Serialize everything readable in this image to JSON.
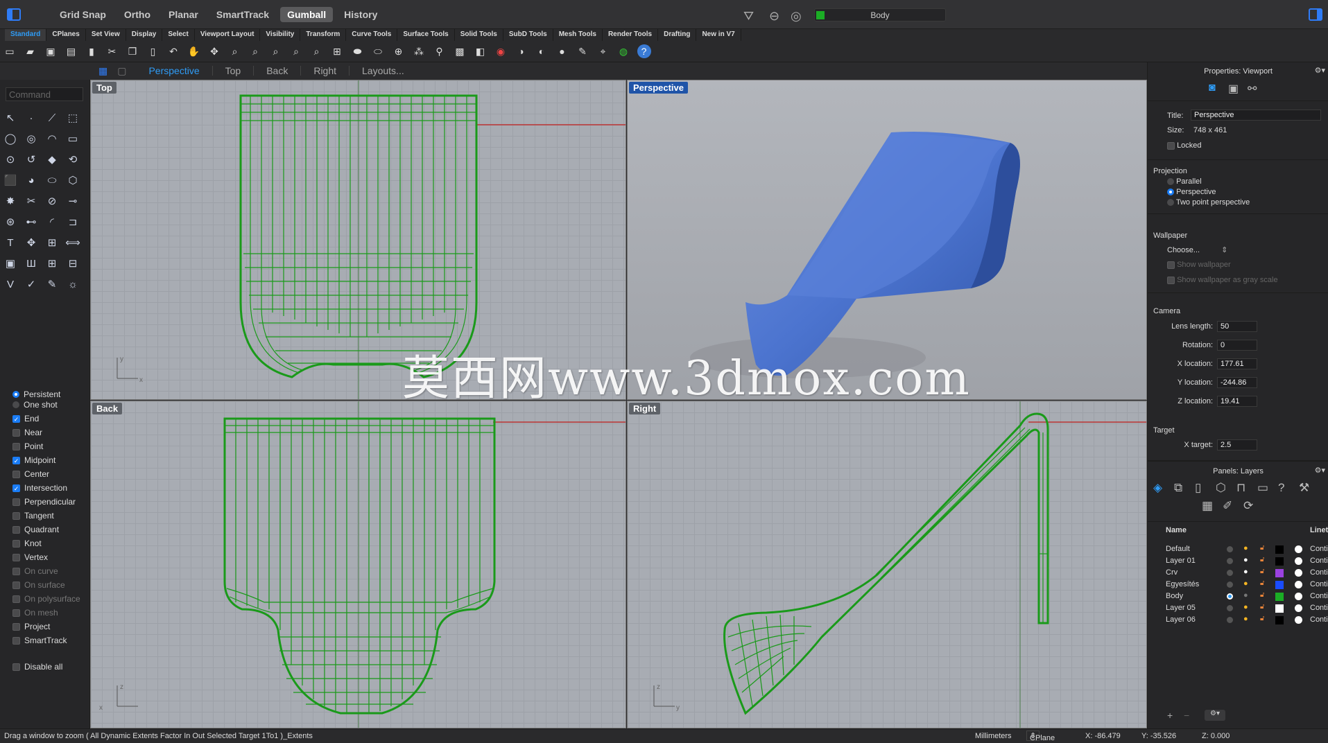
{
  "topbar": {
    "modes": [
      "Grid Snap",
      "Ortho",
      "Planar",
      "SmartTrack",
      "Gumball",
      "History"
    ],
    "active_mode": "Gumball",
    "layer": "Body",
    "layer_color": "#1bad25"
  },
  "tabs": [
    "Standard",
    "CPlanes",
    "Set View",
    "Display",
    "Select",
    "Viewport Layout",
    "Visibility",
    "Transform",
    "Curve Tools",
    "Surface Tools",
    "Solid Tools",
    "SubD Tools",
    "Mesh Tools",
    "Render Tools",
    "Drafting",
    "New in V7"
  ],
  "active_tab": "Standard",
  "viewport_tabs": [
    "Perspective",
    "Top",
    "Back",
    "Right",
    "Layouts..."
  ],
  "active_viewport_tab": "Perspective",
  "command_placeholder": "Command",
  "osnaps": [
    {
      "label": "Persistent",
      "type": "radio",
      "on": true
    },
    {
      "label": "One shot",
      "type": "radio",
      "on": false
    },
    {
      "label": "End",
      "type": "check",
      "on": true
    },
    {
      "label": "Near",
      "type": "check",
      "on": false
    },
    {
      "label": "Point",
      "type": "check",
      "on": false
    },
    {
      "label": "Midpoint",
      "type": "check",
      "on": true
    },
    {
      "label": "Center",
      "type": "check",
      "on": false
    },
    {
      "label": "Intersection",
      "type": "check",
      "on": true
    },
    {
      "label": "Perpendicular",
      "type": "check",
      "on": false
    },
    {
      "label": "Tangent",
      "type": "check",
      "on": false
    },
    {
      "label": "Quadrant",
      "type": "check",
      "on": false
    },
    {
      "label": "Knot",
      "type": "check",
      "on": false
    },
    {
      "label": "Vertex",
      "type": "check",
      "on": false
    },
    {
      "label": "On curve",
      "type": "check",
      "on": false,
      "dim": true
    },
    {
      "label": "On surface",
      "type": "check",
      "on": false,
      "dim": true
    },
    {
      "label": "On polysurface",
      "type": "check",
      "on": false,
      "dim": true
    },
    {
      "label": "On mesh",
      "type": "check",
      "on": false,
      "dim": true
    },
    {
      "label": "Project",
      "type": "check",
      "on": false
    },
    {
      "label": "SmartTrack",
      "type": "check",
      "on": false
    },
    {
      "label": "Disable all",
      "type": "check",
      "on": false
    }
  ],
  "viewports": {
    "top": "Top",
    "perspective": "Perspective",
    "back": "Back",
    "right": "Right"
  },
  "watermark": "莫西网www.3dmox.com",
  "properties": {
    "title": "Properties: Viewport",
    "title_label": "Title:",
    "title_value": "Perspective",
    "size_label": "Size:",
    "size_value": "748 x 461",
    "locked": "Locked",
    "projection": "Projection",
    "proj_options": [
      "Parallel",
      "Perspective",
      "Two point perspective"
    ],
    "proj_selected": "Perspective",
    "wallpaper": "Wallpaper",
    "choose": "Choose...",
    "show_wallpaper": "Show wallpaper",
    "show_gray": "Show wallpaper as gray scale",
    "camera": "Camera",
    "lens_label": "Lens length:",
    "lens": "50",
    "rot_label": "Rotation:",
    "rot": "0",
    "x_label": "X location:",
    "x": "177.61",
    "y_label": "Y location:",
    "y": "-244.86",
    "z_label": "Z location:",
    "z": "19.41",
    "target": "Target",
    "xt_label": "X target:",
    "xt": "2.5"
  },
  "layers_panel": {
    "title": "Panels: Layers",
    "col_name": "Name",
    "col_linetype": "Linet",
    "rows": [
      {
        "name": "Default",
        "color": "#000000",
        "linetype": "Conti",
        "current": false,
        "bulb": "#f5b523"
      },
      {
        "name": "Layer 01",
        "color": "#000000",
        "linetype": "Conti",
        "current": false,
        "bulb": "#ffffff"
      },
      {
        "name": "Crv",
        "color": "#9b42e0",
        "linetype": "Conti",
        "current": false,
        "bulb": "#ffffff"
      },
      {
        "name": "Egyesítés",
        "color": "#1a4cff",
        "linetype": "Conti",
        "current": false,
        "bulb": "#f5b523"
      },
      {
        "name": "Body",
        "color": "#1bad25",
        "linetype": "Conti",
        "current": true,
        "bulb": "#777777"
      },
      {
        "name": "Layer 05",
        "color": "#ffffff",
        "linetype": "Conti",
        "current": false,
        "bulb": "#f5b523"
      },
      {
        "name": "Layer 06",
        "color": "#000000",
        "linetype": "Conti",
        "current": false,
        "bulb": "#f5b523"
      }
    ]
  },
  "status": {
    "prompt": "Drag a window to zoom ( All Dynamic Extents Factor In Out Selected Target 1To1 )_Extents",
    "units": "Millimeters",
    "cplane": "CPlane",
    "x": "X: -86.479",
    "y": "Y: -35.526",
    "z": "Z: 0.000"
  }
}
